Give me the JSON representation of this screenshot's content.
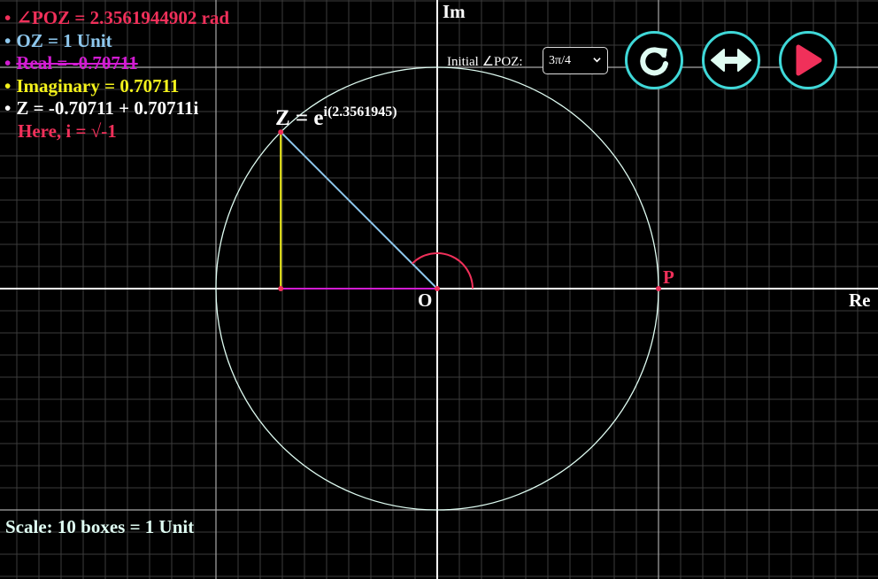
{
  "info": {
    "angle": "∠POZ = 2.3561944902 rad",
    "modulus": "OZ = 1 Unit",
    "real": "Real = -0.70711",
    "imaginary": "Imaginary = 0.70711",
    "z": "Z = -0.70711 + 0.70711i",
    "i_note": "Here, i = √-1",
    "bullet": "•"
  },
  "scale_note": "Scale: 10 boxes = 1 Unit",
  "axes": {
    "real_label": "Re",
    "imag_label": "Im",
    "origin_label": "O",
    "point_p": "P"
  },
  "z_label": {
    "base": "Z = e",
    "exponent": "i(2.3561945)"
  },
  "controls": {
    "initial_angle_label": "Initial ∠POZ:",
    "initial_angle_value": "3π/4",
    "buttons": [
      "reset",
      "flip-direction",
      "play"
    ]
  },
  "colors": {
    "angle": "#f0305a",
    "modulus": "#8ec8ee",
    "real": "#d21cd2",
    "imaginary": "#f4f21c",
    "z": "#ffffff",
    "i_note": "#f0305a",
    "scale": "#dffcf2",
    "accent": "#3fd8d8"
  },
  "plot": {
    "theta_rad": 2.3561944902,
    "radius_units": 1,
    "boxes_per_unit": 10
  }
}
